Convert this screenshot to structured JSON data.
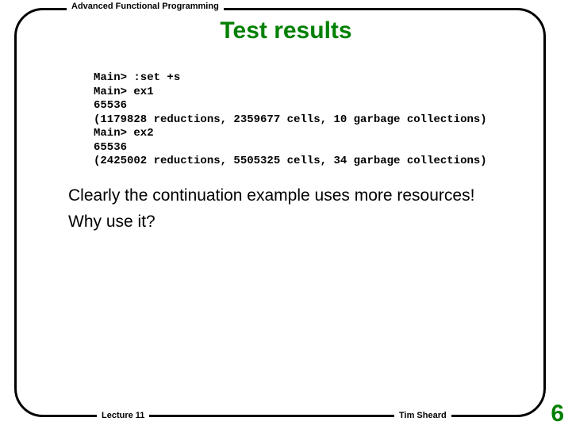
{
  "header": {
    "course": "Advanced Functional Programming"
  },
  "title": "Test results",
  "code": "Main> :set +s\nMain> ex1\n65536\n(1179828 reductions, 2359677 cells, 10 garbage collections)\nMain> ex2\n65536\n(2425002 reductions, 5505325 cells, 34 garbage collections)",
  "body": {
    "p1": "Clearly the continuation example uses more resources!",
    "p2": "Why use it?"
  },
  "footer": {
    "lecture": "Lecture 11",
    "author": "Tim Sheard"
  },
  "page_number": "6"
}
